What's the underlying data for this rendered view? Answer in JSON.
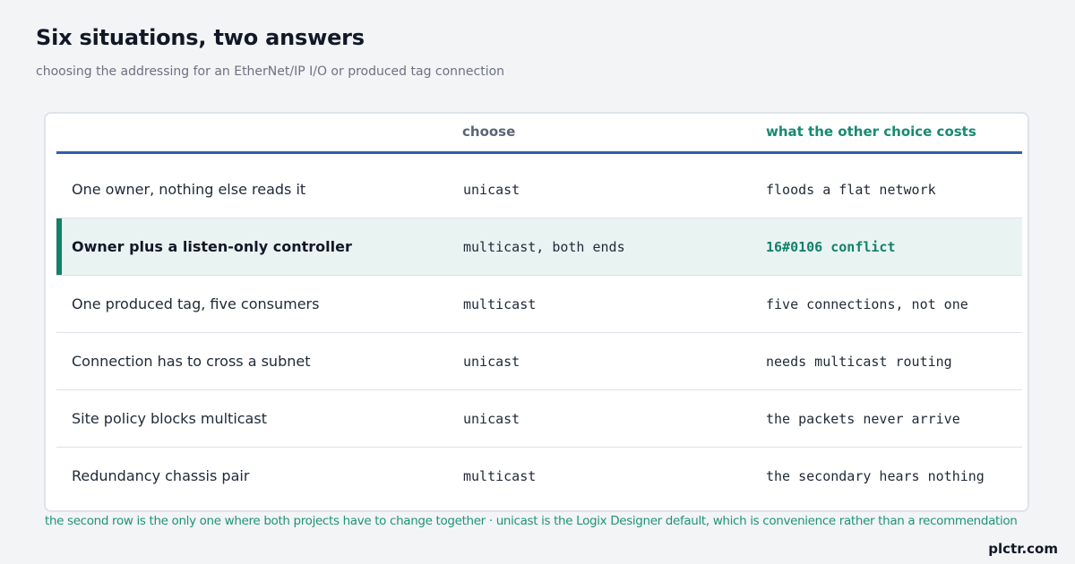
{
  "title": "Six situations, two answers",
  "subtitle": "choosing the addressing for an EtherNet/IP I/O or produced tag connection",
  "table": {
    "headers": {
      "situation": "",
      "choose": "choose",
      "cost": "what the other choice costs"
    },
    "highlight_color": "#14806a",
    "rows": [
      {
        "situation": "One owner, nothing else reads it",
        "choose": "unicast",
        "cost": "floods a flat network"
      },
      {
        "situation": "Owner plus a listen-only controller",
        "choose": "multicast, both ends",
        "cost": "16#0106 conflict",
        "highlighted": true
      },
      {
        "situation": "One produced tag, five consumers",
        "choose": "multicast",
        "cost": "five connections, not one"
      },
      {
        "situation": "Connection has to cross a subnet",
        "choose": "unicast",
        "cost": "needs multicast routing"
      },
      {
        "situation": "Site policy blocks multicast",
        "choose": "unicast",
        "cost": "the packets never arrive"
      },
      {
        "situation": "Redundancy chassis pair",
        "choose": "multicast",
        "cost": "the secondary hears nothing"
      }
    ]
  },
  "footnote": "the second row is the only one where both projects have to change together · unicast is the Logix Designer default, which is convenience rather than a recommendation",
  "brand": "plctr.com"
}
